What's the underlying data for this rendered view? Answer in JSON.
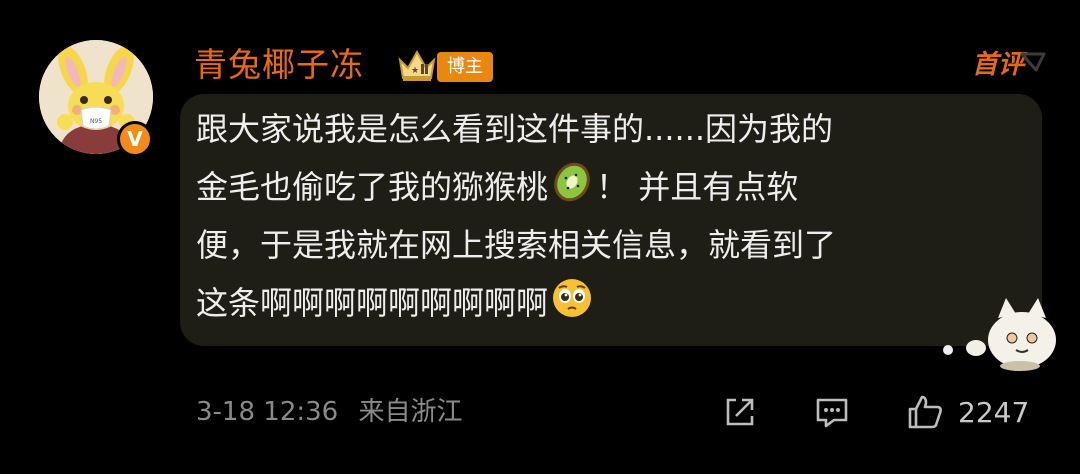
{
  "comment": {
    "username": "青兔椰子冻",
    "role_tag": "博主",
    "first_tag": "首评",
    "verified_badge": "V",
    "lines": [
      "跟大家说我是怎么看到这件事的......因为我的",
      "金毛也偷吃了我的猕猴桃",
      "便，于是我就在网上搜索相关信息，就看到了",
      "这条啊啊啊啊啊啊啊啊啊"
    ],
    "line2_after": "！ 并且有点软",
    "emoji_kiwi": "kiwi-emoji",
    "emoji_pleading": "pleading-face-emoji",
    "avatar_mask_text": "N95",
    "date": "3-18 12:36",
    "location": "来自浙江",
    "like_count": "2247"
  },
  "icons": {
    "share": "share-icon",
    "reply": "comment-icon",
    "like": "thumbs-up-icon"
  },
  "colors": {
    "background": "#000000",
    "bubble": "#1f1e16",
    "username": "#e86b0f",
    "role_tag_bg": "#e9880e",
    "first_tag": "#e46b14",
    "text": "#eeeeee",
    "meta": "#8a8a8a"
  }
}
